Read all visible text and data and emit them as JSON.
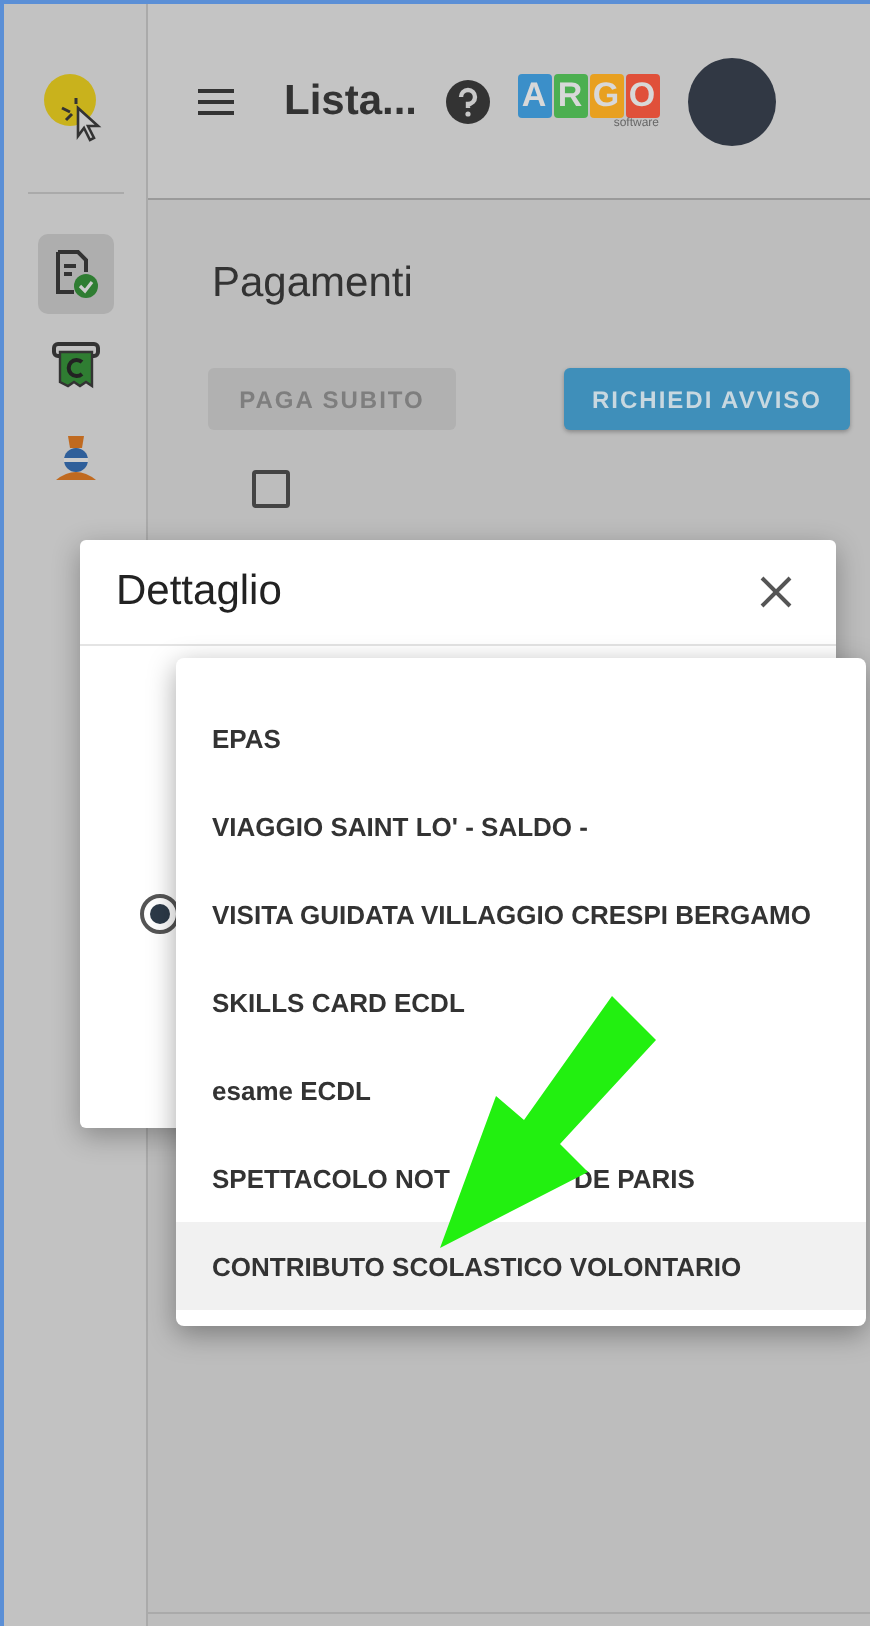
{
  "header": {
    "title": "Lista...",
    "logo": {
      "letters": [
        "A",
        "R",
        "G",
        "O"
      ],
      "caption": "software"
    }
  },
  "sidebar": {
    "items": [
      {
        "kind": "document",
        "selected": true
      },
      {
        "kind": "receipt",
        "selected": false
      },
      {
        "kind": "person",
        "selected": false
      }
    ]
  },
  "page": {
    "title": "Pagamenti",
    "buttons": [
      {
        "label": "PAGA SUBITO",
        "disabled": true
      },
      {
        "label": "RICHIEDI AVVISO",
        "disabled": false
      }
    ],
    "select_all": {
      "checked": false
    }
  },
  "dialog": {
    "title": "Dettaglio",
    "radio": {
      "checked": true
    }
  },
  "menu": {
    "items": [
      {
        "label_parts": [
          "EPAS"
        ],
        "selected": false
      },
      {
        "label_parts": [
          "VIAGGIO SAINT LO' - SALDO -"
        ],
        "selected": false
      },
      {
        "label_parts": [
          "VISITA GUIDATA VILLAGGIO CRESPI BERGAMO"
        ],
        "selected": false
      },
      {
        "label_parts": [
          "SKILLS CARD ECDL"
        ],
        "selected": false
      },
      {
        "label_parts": [
          "esame ECDL"
        ],
        "selected": false
      },
      {
        "label_parts": [
          "SPETTACOLO NOT",
          "DE PARIS"
        ],
        "selected": false
      },
      {
        "label_parts": [
          "CONTRIBUTO SCOLASTICO VOLONTARIO"
        ],
        "selected": true
      }
    ]
  }
}
